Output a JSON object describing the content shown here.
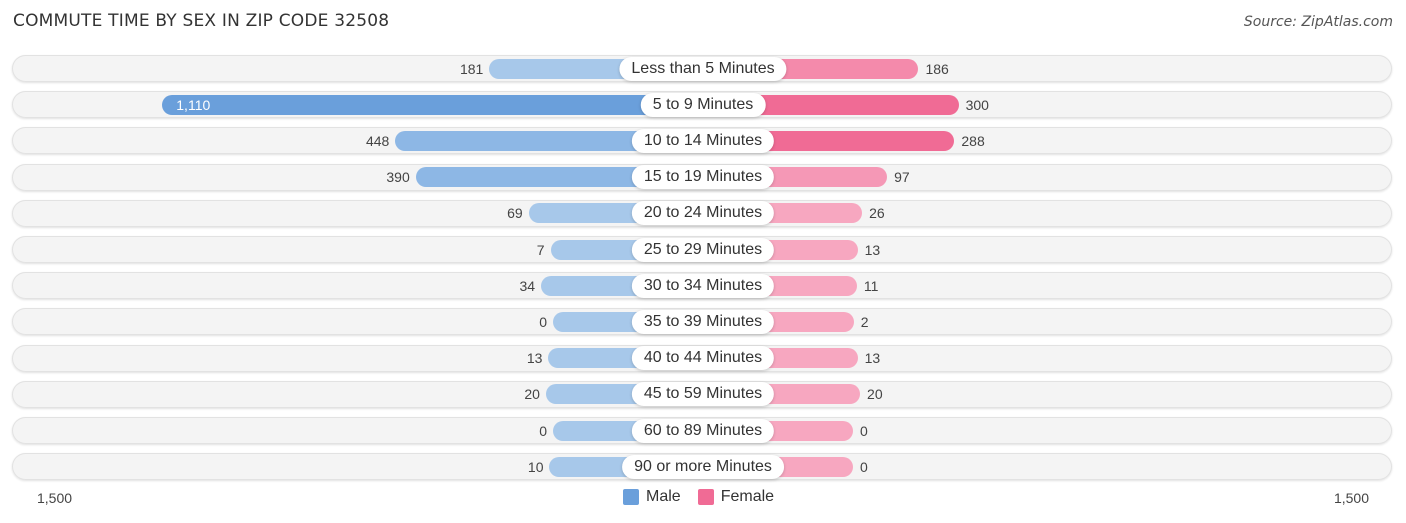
{
  "header": {
    "title": "COMMUTE TIME BY SEX IN ZIP CODE 32508",
    "source": "Source: ZipAtlas.com"
  },
  "colors": {
    "male": "#6a9fdb",
    "male_light": "#a7c8ea",
    "female": "#f06b95",
    "female_light": "#f7a7c0"
  },
  "chart_data": {
    "type": "bar",
    "orientation": "horizontal-diverging",
    "title": "COMMUTE TIME BY SEX IN ZIP CODE 32508",
    "categories": [
      "Less than 5 Minutes",
      "5 to 9 Minutes",
      "10 to 14 Minutes",
      "15 to 19 Minutes",
      "20 to 24 Minutes",
      "25 to 29 Minutes",
      "30 to 34 Minutes",
      "35 to 39 Minutes",
      "40 to 44 Minutes",
      "45 to 59 Minutes",
      "60 to 89 Minutes",
      "90 or more Minutes"
    ],
    "series": [
      {
        "name": "Male",
        "values": [
          181,
          1110,
          448,
          390,
          69,
          7,
          34,
          0,
          13,
          20,
          0,
          10
        ],
        "labels": [
          "181",
          "1,110",
          "448",
          "390",
          "69",
          "7",
          "34",
          "0",
          "13",
          "20",
          "0",
          "10"
        ]
      },
      {
        "name": "Female",
        "values": [
          186,
          300,
          288,
          97,
          26,
          13,
          11,
          2,
          13,
          20,
          0,
          0
        ],
        "labels": [
          "186",
          "300",
          "288",
          "97",
          "26",
          "13",
          "11",
          "2",
          "13",
          "20",
          "0",
          "0"
        ]
      }
    ],
    "axis": {
      "left_label": "1,500",
      "right_label": "1,500",
      "range": [
        -1500,
        1500
      ]
    },
    "legend": {
      "position": "bottom-center",
      "entries": [
        "Male",
        "Female"
      ]
    }
  }
}
